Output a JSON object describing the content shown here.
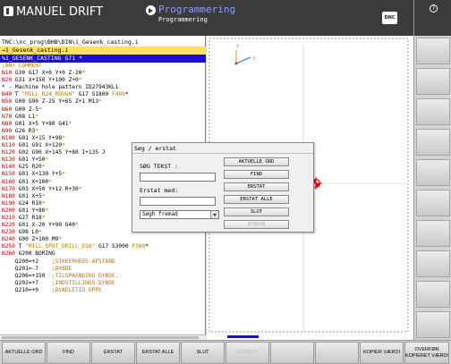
{
  "header": {
    "mode_left": "MANUEL DRIFT",
    "mode_right_title": "Programmering",
    "mode_right_sub": "Programmering",
    "dnc_label": "DNC"
  },
  "program": {
    "path": "TNC:\\nc_prog\\BHB\\DIN\\i_Gesenk_casting.i",
    "active_file": "→1_Gesenk_casting.i",
    "selected_line": "%1_GESENK_CASTING G71 *",
    "lines": [
      [
        [
          "cm",
          ";ANY COMMENT"
        ]
      ],
      [
        [
          "n",
          "N10"
        ],
        [
          "",
          " G30 G17 X+0 Y+0 Z-20"
        ],
        [
          "c",
          "*"
        ]
      ],
      [
        [
          "n",
          "N20"
        ],
        [
          "",
          " G31 X+150 Y+100 Z+0"
        ],
        [
          "c",
          "*"
        ]
      ],
      [
        [
          "",
          "* - Machine hole pattern ID27943KL1"
        ]
      ],
      [
        [
          "n",
          "N40"
        ],
        [
          "",
          " T "
        ],
        [
          "c",
          "\"MILL_D24_ROUGH\""
        ],
        [
          "",
          " G17 S1800 "
        ],
        [
          "c",
          "F400"
        ],
        [
          "",
          "*"
        ]
      ],
      [
        [
          "n",
          "N50"
        ],
        [
          "",
          " G00 G90 Z-25 Y+65 Z+1 M13"
        ],
        [
          "c",
          "*"
        ]
      ],
      [
        [
          "n",
          "N60"
        ],
        [
          "",
          " G00 Z-5"
        ],
        [
          "c",
          "*"
        ]
      ],
      [
        [
          "n",
          "N70"
        ],
        [
          "",
          " G98 L1"
        ],
        [
          "c",
          "*"
        ]
      ],
      [
        [
          "n",
          "N80"
        ],
        [
          "",
          " G01 X+5 Y+80 G41"
        ],
        [
          "c",
          "*"
        ]
      ],
      [
        [
          "n",
          "N90"
        ],
        [
          "",
          " G26 R3"
        ],
        [
          "c",
          "*"
        ]
      ],
      [
        [
          "n",
          "N100"
        ],
        [
          "",
          " G01 X+15 Y+98"
        ],
        [
          "c",
          "*"
        ]
      ],
      [
        [
          "n",
          "N110"
        ],
        [
          "",
          " G01 G91 X+120"
        ],
        [
          "c",
          "*"
        ]
      ],
      [
        [
          "n",
          "N120"
        ],
        [
          "",
          " G02 G90 X+145 Y+80 I+135 J"
        ]
      ],
      [
        [
          "n",
          "N130"
        ],
        [
          "",
          " G01 Y+50"
        ],
        [
          "c",
          "*"
        ]
      ],
      [
        [
          "n",
          "N140"
        ],
        [
          "",
          " G25 R20"
        ],
        [
          "c",
          "*"
        ]
      ],
      [
        [
          "n",
          "N150"
        ],
        [
          "",
          " G01 X+130 Y+5"
        ],
        [
          "c",
          "*"
        ]
      ],
      [
        [
          "n",
          "N160"
        ],
        [
          "",
          " G01 X+100"
        ],
        [
          "c",
          "*"
        ]
      ],
      [
        [
          "n",
          "N170"
        ],
        [
          "",
          " G03 X+50 Y+12 R+30"
        ],
        [
          "c",
          "*"
        ]
      ],
      [
        [
          "n",
          "N180"
        ],
        [
          "",
          " G01 X+5"
        ],
        [
          "c",
          "*"
        ]
      ],
      [
        [
          "n",
          "N190"
        ],
        [
          "",
          " G24 R10"
        ],
        [
          "c",
          "*"
        ]
      ],
      [
        [
          "n",
          "N200"
        ],
        [
          "",
          " G01 Y+80"
        ],
        [
          "c",
          "*"
        ]
      ],
      [
        [
          "n",
          "N210"
        ],
        [
          "",
          " G27 R18"
        ],
        [
          "c",
          "*"
        ]
      ],
      [
        [
          "n",
          "N220"
        ],
        [
          "",
          " G01 X-20 Y+90 G40"
        ],
        [
          "c",
          "*"
        ]
      ],
      [
        [
          "n",
          "N230"
        ],
        [
          "",
          " G98 L0"
        ],
        [
          "c",
          "*"
        ]
      ],
      [
        [
          "n",
          "N240"
        ],
        [
          "",
          " G00 Z+100 M9"
        ],
        [
          "c",
          "*"
        ]
      ],
      [
        [
          "n",
          "N250"
        ],
        [
          "",
          " T "
        ],
        [
          "c",
          "\"MILL_SPOT_DRILL_D16\""
        ],
        [
          "",
          " G17 S3000 "
        ],
        [
          "c",
          "F300"
        ],
        [
          "",
          "*"
        ]
      ],
      [
        [
          "n",
          "N260"
        ],
        [
          "",
          " G200 BORING"
        ]
      ],
      [
        [
          "",
          "    Q200=+2    "
        ],
        [
          "cm",
          ";SIKKERHEDS-AFSTAND"
        ]
      ],
      [
        [
          "",
          "    Q201=-7    "
        ],
        [
          "cm",
          ";DYBDE"
        ]
      ],
      [
        [
          "",
          "    Q206=+150  "
        ],
        [
          "cm",
          ";TILSPAENDING DYBDE."
        ]
      ],
      [
        [
          "",
          "    Q202=+7    "
        ],
        [
          "cm",
          ";INDSTILLINGS-DYBDE"
        ]
      ],
      [
        [
          "",
          "    Q210=+0    "
        ],
        [
          "cm",
          ";DVAELETID OPPE"
        ]
      ]
    ]
  },
  "graphic": {
    "axis_y": "Y",
    "axis_x": "X"
  },
  "dialog": {
    "title": "Søg / erstat",
    "search_label": "SØG TEKST :",
    "search_value": "",
    "replace_label": "Erstat med:",
    "replace_value": "",
    "direction_value": "Søgh fremad",
    "buttons": [
      "AKTUELLE ORD",
      "FIND",
      "ERSTAT",
      "ERSTAT ALLE",
      "SLUT",
      "AFBRYD"
    ]
  },
  "softkeys": [
    "AKTUELLE ORD",
    "FIND",
    "ERSTAT",
    "ERSTAT ALLE",
    "SLUT",
    "AFBRYD",
    "",
    "",
    "KOPIER VÆRDI",
    "OVERFØR KOPIERET VÆRDI"
  ],
  "colors": {
    "selection": "#1a0fd6",
    "line_number": "#c00000",
    "active_row": "#ffe066"
  }
}
